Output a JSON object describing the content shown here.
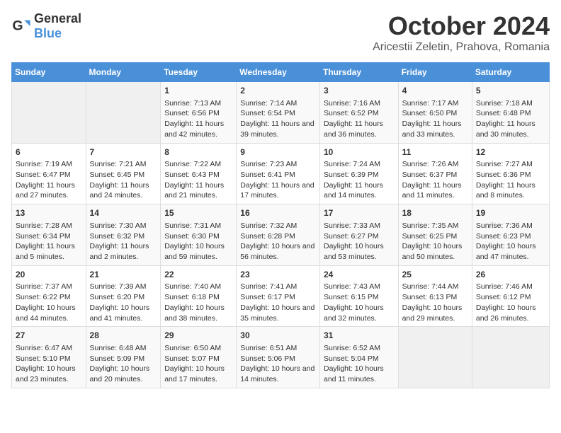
{
  "header": {
    "logo_general": "General",
    "logo_blue": "Blue",
    "month": "October 2024",
    "location": "Aricestii Zeletin, Prahova, Romania"
  },
  "days_of_week": [
    "Sunday",
    "Monday",
    "Tuesday",
    "Wednesday",
    "Thursday",
    "Friday",
    "Saturday"
  ],
  "weeks": [
    [
      {
        "day": "",
        "content": ""
      },
      {
        "day": "",
        "content": ""
      },
      {
        "day": "1",
        "content": "Sunrise: 7:13 AM\nSunset: 6:56 PM\nDaylight: 11 hours and 42 minutes."
      },
      {
        "day": "2",
        "content": "Sunrise: 7:14 AM\nSunset: 6:54 PM\nDaylight: 11 hours and 39 minutes."
      },
      {
        "day": "3",
        "content": "Sunrise: 7:16 AM\nSunset: 6:52 PM\nDaylight: 11 hours and 36 minutes."
      },
      {
        "day": "4",
        "content": "Sunrise: 7:17 AM\nSunset: 6:50 PM\nDaylight: 11 hours and 33 minutes."
      },
      {
        "day": "5",
        "content": "Sunrise: 7:18 AM\nSunset: 6:48 PM\nDaylight: 11 hours and 30 minutes."
      }
    ],
    [
      {
        "day": "6",
        "content": "Sunrise: 7:19 AM\nSunset: 6:47 PM\nDaylight: 11 hours and 27 minutes."
      },
      {
        "day": "7",
        "content": "Sunrise: 7:21 AM\nSunset: 6:45 PM\nDaylight: 11 hours and 24 minutes."
      },
      {
        "day": "8",
        "content": "Sunrise: 7:22 AM\nSunset: 6:43 PM\nDaylight: 11 hours and 21 minutes."
      },
      {
        "day": "9",
        "content": "Sunrise: 7:23 AM\nSunset: 6:41 PM\nDaylight: 11 hours and 17 minutes."
      },
      {
        "day": "10",
        "content": "Sunrise: 7:24 AM\nSunset: 6:39 PM\nDaylight: 11 hours and 14 minutes."
      },
      {
        "day": "11",
        "content": "Sunrise: 7:26 AM\nSunset: 6:37 PM\nDaylight: 11 hours and 11 minutes."
      },
      {
        "day": "12",
        "content": "Sunrise: 7:27 AM\nSunset: 6:36 PM\nDaylight: 11 hours and 8 minutes."
      }
    ],
    [
      {
        "day": "13",
        "content": "Sunrise: 7:28 AM\nSunset: 6:34 PM\nDaylight: 11 hours and 5 minutes."
      },
      {
        "day": "14",
        "content": "Sunrise: 7:30 AM\nSunset: 6:32 PM\nDaylight: 11 hours and 2 minutes."
      },
      {
        "day": "15",
        "content": "Sunrise: 7:31 AM\nSunset: 6:30 PM\nDaylight: 10 hours and 59 minutes."
      },
      {
        "day": "16",
        "content": "Sunrise: 7:32 AM\nSunset: 6:28 PM\nDaylight: 10 hours and 56 minutes."
      },
      {
        "day": "17",
        "content": "Sunrise: 7:33 AM\nSunset: 6:27 PM\nDaylight: 10 hours and 53 minutes."
      },
      {
        "day": "18",
        "content": "Sunrise: 7:35 AM\nSunset: 6:25 PM\nDaylight: 10 hours and 50 minutes."
      },
      {
        "day": "19",
        "content": "Sunrise: 7:36 AM\nSunset: 6:23 PM\nDaylight: 10 hours and 47 minutes."
      }
    ],
    [
      {
        "day": "20",
        "content": "Sunrise: 7:37 AM\nSunset: 6:22 PM\nDaylight: 10 hours and 44 minutes."
      },
      {
        "day": "21",
        "content": "Sunrise: 7:39 AM\nSunset: 6:20 PM\nDaylight: 10 hours and 41 minutes."
      },
      {
        "day": "22",
        "content": "Sunrise: 7:40 AM\nSunset: 6:18 PM\nDaylight: 10 hours and 38 minutes."
      },
      {
        "day": "23",
        "content": "Sunrise: 7:41 AM\nSunset: 6:17 PM\nDaylight: 10 hours and 35 minutes."
      },
      {
        "day": "24",
        "content": "Sunrise: 7:43 AM\nSunset: 6:15 PM\nDaylight: 10 hours and 32 minutes."
      },
      {
        "day": "25",
        "content": "Sunrise: 7:44 AM\nSunset: 6:13 PM\nDaylight: 10 hours and 29 minutes."
      },
      {
        "day": "26",
        "content": "Sunrise: 7:46 AM\nSunset: 6:12 PM\nDaylight: 10 hours and 26 minutes."
      }
    ],
    [
      {
        "day": "27",
        "content": "Sunrise: 6:47 AM\nSunset: 5:10 PM\nDaylight: 10 hours and 23 minutes."
      },
      {
        "day": "28",
        "content": "Sunrise: 6:48 AM\nSunset: 5:09 PM\nDaylight: 10 hours and 20 minutes."
      },
      {
        "day": "29",
        "content": "Sunrise: 6:50 AM\nSunset: 5:07 PM\nDaylight: 10 hours and 17 minutes."
      },
      {
        "day": "30",
        "content": "Sunrise: 6:51 AM\nSunset: 5:06 PM\nDaylight: 10 hours and 14 minutes."
      },
      {
        "day": "31",
        "content": "Sunrise: 6:52 AM\nSunset: 5:04 PM\nDaylight: 10 hours and 11 minutes."
      },
      {
        "day": "",
        "content": ""
      },
      {
        "day": "",
        "content": ""
      }
    ]
  ]
}
